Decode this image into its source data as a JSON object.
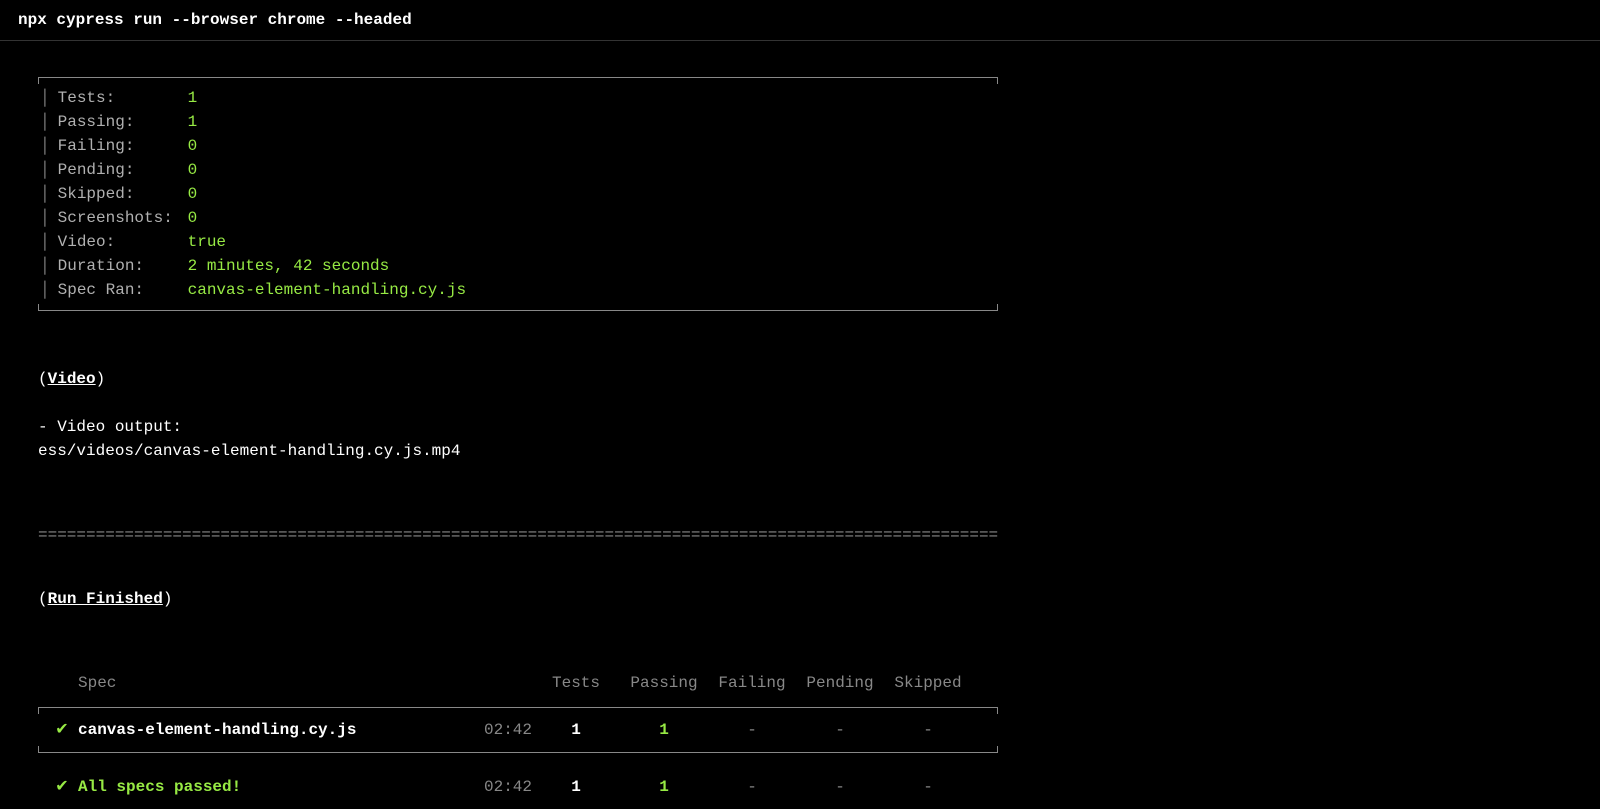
{
  "command": "npx cypress run --browser chrome --headed",
  "stats": {
    "tests": {
      "label": "Tests:",
      "value": "1"
    },
    "passing": {
      "label": "Passing:",
      "value": "1"
    },
    "failing": {
      "label": "Failing:",
      "value": "0"
    },
    "pending": {
      "label": "Pending:",
      "value": "0"
    },
    "skipped": {
      "label": "Skipped:",
      "value": "0"
    },
    "screenshots": {
      "label": "Screenshots:",
      "value": "0"
    },
    "video": {
      "label": "Video:",
      "value": "true"
    },
    "duration": {
      "label": "Duration:",
      "value": "2 minutes, 42 seconds"
    },
    "specRan": {
      "label": "Spec Ran:",
      "value": "canvas-element-handling.cy.js"
    }
  },
  "videoSection": {
    "header": "Video",
    "outputLabel": "  -  Video output:",
    "path": "ess/videos/canvas-element-handling.cy.js.mp4"
  },
  "divider": "====================================================================================================",
  "runFinished": {
    "header": "Run Finished"
  },
  "specTable": {
    "headers": {
      "spec": "Spec",
      "tests": "Tests",
      "passing": "Passing",
      "failing": "Failing",
      "pending": "Pending",
      "skipped": "Skipped"
    },
    "row": {
      "check": "✔",
      "name": "canvas-element-handling.cy.js",
      "time": "02:42",
      "tests": "1",
      "passing": "1",
      "failing": "-",
      "pending": "-",
      "skipped": "-"
    },
    "summary": {
      "check": "✔",
      "text": "All specs passed!",
      "time": "02:42",
      "tests": "1",
      "passing": "1",
      "failing": "-",
      "pending": "-",
      "skipped": "-"
    }
  }
}
